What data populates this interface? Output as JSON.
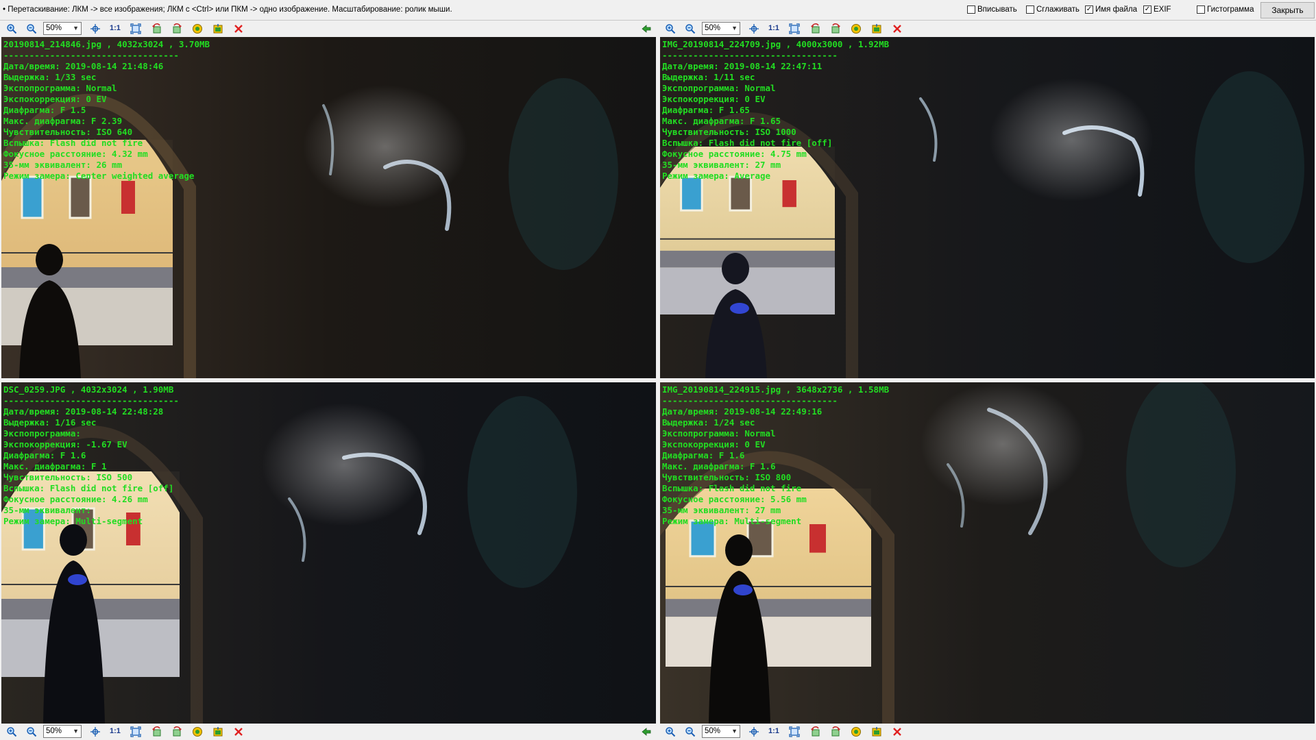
{
  "topbar": {
    "hint": "• Перетаскивание: ЛКМ -> все изображения; ЛКМ с <Ctrl> или ПКМ -> одно изображение. Масштабирование: ролик мыши.",
    "options": [
      {
        "label": "Вписывать",
        "checked": false
      },
      {
        "label": "Сглаживать",
        "checked": false
      },
      {
        "label": "Имя файла",
        "checked": true
      },
      {
        "label": "EXIF",
        "checked": true
      },
      {
        "label": "Гистограмма",
        "checked": false
      }
    ],
    "close_label": "Закрыть"
  },
  "toolbar": {
    "zoom": "50%",
    "actual_size": "1:1"
  },
  "colors": {
    "exif_text": "#22dd22",
    "close_icon": "#e02020"
  },
  "panels": [
    {
      "header": "20190814_214846.jpg , 4032x3024 , 3.70MB",
      "separator": "----------------------------------",
      "lines": [
        "Дата/время: 2019-08-14 21:48:46",
        "Выдержка: 1/33 sec",
        "Экспопрограмма: Normal",
        "Экспокоррекция: 0 EV",
        "Диафрагма: F 1.5",
        "Макс. диафрагма: F 2.39",
        "Чувствительность: ISO 640",
        "Вспышка: Flash did not fire",
        "Фокусное расстояние: 4.32 mm",
        "35-мм эквивалент: 26 mm",
        "Режим замера: Center weighted average"
      ]
    },
    {
      "header": "IMG_20190814_224709.jpg , 4000x3000 , 1.92MB",
      "separator": "----------------------------------",
      "lines": [
        "Дата/время: 2019-08-14 22:47:11",
        "Выдержка: 1/11 sec",
        "Экспопрограмма: Normal",
        "Экспокоррекция: 0 EV",
        "Диафрагма: F 1.65",
        "Макс. диафрагма: F 1.65",
        "Чувствительность: ISO 1000",
        "Вспышка: Flash did not fire [off]",
        "Фокусное расстояние: 4.75 mm",
        "35-мм эквивалент: 27 mm",
        "Режим замера: Average"
      ]
    },
    {
      "header": "DSC_0259.JPG , 4032x3024 , 1.90MB",
      "separator": "----------------------------------",
      "lines": [
        "Дата/время: 2019-08-14 22:48:28",
        "Выдержка: 1/16 sec",
        "Экспопрограмма:",
        "Экспокоррекция: -1.67 EV",
        "Диафрагма: F 1.6",
        "Макс. диафрагма: F 1",
        "Чувствительность: ISO 500",
        "Вспышка: Flash did not fire [off]",
        "Фокусное расстояние: 4.26 mm",
        "35-мм эквивалент:",
        "Режим замера: Multi-segment"
      ]
    },
    {
      "header": "IMG_20190814_224915.jpg , 3648x2736 , 1.58MB",
      "separator": "----------------------------------",
      "lines": [
        "Дата/время: 2019-08-14 22:49:16",
        "Выдержка: 1/24 sec",
        "Экспопрограмма: Normal",
        "Экспокоррекция: 0 EV",
        "Диафрагма: F 1.6",
        "Макс. диафрагма: F 1.6",
        "Чувствительность: ISO 800",
        "Вспышка: Flash did not fire",
        "Фокусное расстояние: 5.56 mm",
        "35-мм эквивалент: 27 mm",
        "Режим замера: Multi-segment"
      ]
    }
  ]
}
